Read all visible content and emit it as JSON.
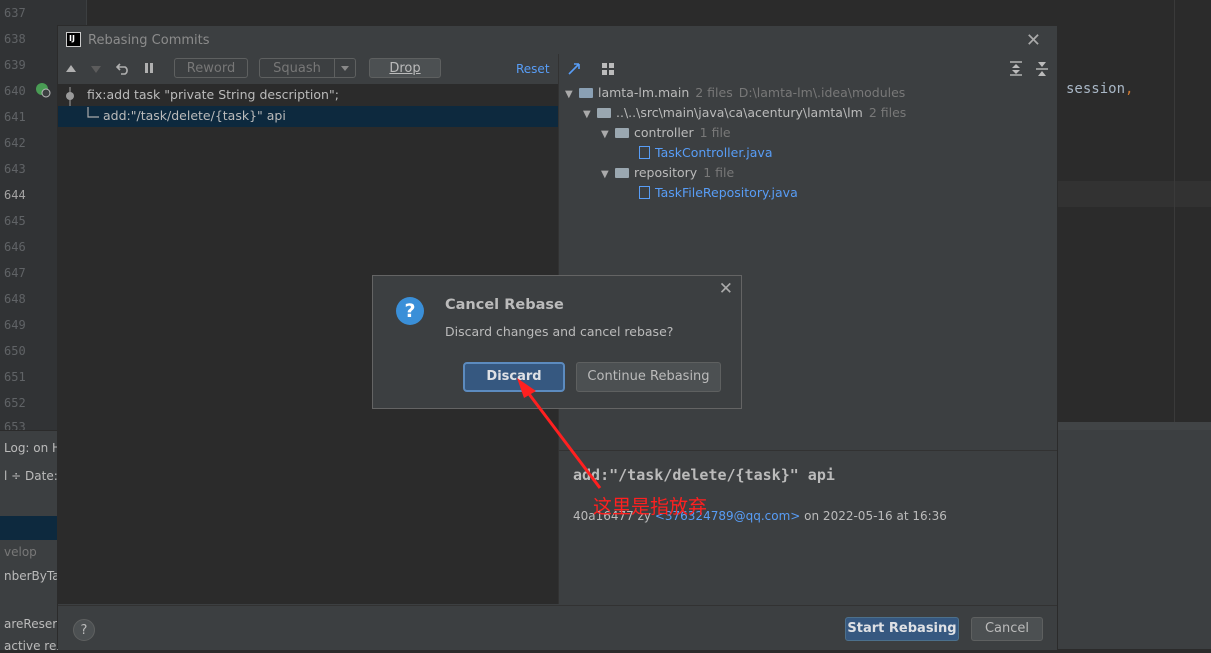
{
  "editor": {
    "line_numbers": [
      "637",
      "638",
      "639",
      "640",
      "641",
      "642",
      "643",
      "644",
      "645",
      "646",
      "647",
      "648",
      "649",
      "650",
      "651",
      "652",
      "653"
    ],
    "code_fragment": "session",
    "code_comma": ",",
    "bottom_left_items": [
      "Log: on H",
      "l ÷  Date: A",
      "velop",
      "nberByTas",
      "areReserv",
      "active res"
    ]
  },
  "dialog": {
    "title": "Rebasing Commits",
    "app_logo": "IJ",
    "close_glyph": "✕",
    "toolbar": {
      "reword": "Reword",
      "squash": "Squash",
      "drop": "Drop",
      "reset": "Reset"
    },
    "commits": [
      {
        "message": "fix:add task \"private String description\";"
      },
      {
        "message": "add:\"/task/delete/{task}\" api"
      }
    ],
    "changes_tree": {
      "module": {
        "name": "lamta-lm.main",
        "count": "2 files",
        "path": "D:\\lamta-lm\\.idea\\modules"
      },
      "package": {
        "name": "..\\..\\src\\main\\java\\ca\\acentury\\lamta\\lm",
        "count": "2 files"
      },
      "folders": [
        {
          "name": "controller",
          "count": "1 file",
          "file": "TaskController.java"
        },
        {
          "name": "repository",
          "count": "1 file",
          "file": "TaskFileRepository.java"
        }
      ]
    },
    "details": {
      "subject": "add:\"/task/delete/{task}\" api",
      "hash_author": "40a16477 zy",
      "email": "<376324789@qq.com>",
      "date": "on 2022-05-16 at 16:36"
    },
    "footer": {
      "help": "?",
      "start_rebasing": "Start Rebasing",
      "cancel": "Cancel"
    }
  },
  "confirm": {
    "title": "Cancel Rebase",
    "message": "Discard changes and cancel rebase?",
    "discard": "Discard",
    "continue": "Continue Rebasing",
    "close_glyph": "✕"
  },
  "annotation": {
    "text": "这里是指放弃",
    "color": "#ff2020"
  },
  "colors": {
    "accent": "#365880",
    "link": "#589df6",
    "background": "#3c3f41"
  }
}
